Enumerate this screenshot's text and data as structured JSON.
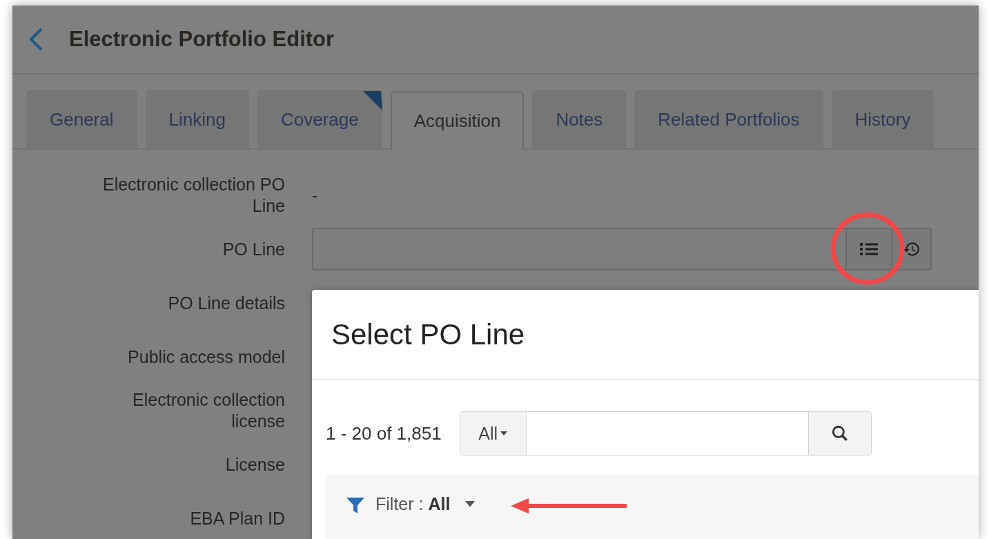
{
  "header": {
    "title": "Electronic Portfolio Editor"
  },
  "tabs": [
    {
      "label": "General",
      "selected": false,
      "flagged": false
    },
    {
      "label": "Linking",
      "selected": false,
      "flagged": false
    },
    {
      "label": "Coverage",
      "selected": false,
      "flagged": true
    },
    {
      "label": "Acquisition",
      "selected": true,
      "flagged": false
    },
    {
      "label": "Notes",
      "selected": false,
      "flagged": false
    },
    {
      "label": "Related Portfolios",
      "selected": false,
      "flagged": false
    },
    {
      "label": "History",
      "selected": false,
      "flagged": false
    }
  ],
  "form": {
    "rows": [
      {
        "label": "Electronic collection PO Line",
        "kind": "text",
        "value": "-"
      },
      {
        "label": "PO Line",
        "kind": "lookup"
      },
      {
        "label": "PO Line details",
        "kind": "empty"
      },
      {
        "label": "Public access model",
        "kind": "empty"
      },
      {
        "label": "Electronic collection license",
        "kind": "empty"
      },
      {
        "label": "License",
        "kind": "empty"
      },
      {
        "label": "EBA Plan ID",
        "kind": "empty"
      }
    ]
  },
  "dialog": {
    "title": "Select PO Line",
    "count": "1 - 20 of 1,851",
    "scope": "All",
    "filter": "Filter : **All**"
  }
}
